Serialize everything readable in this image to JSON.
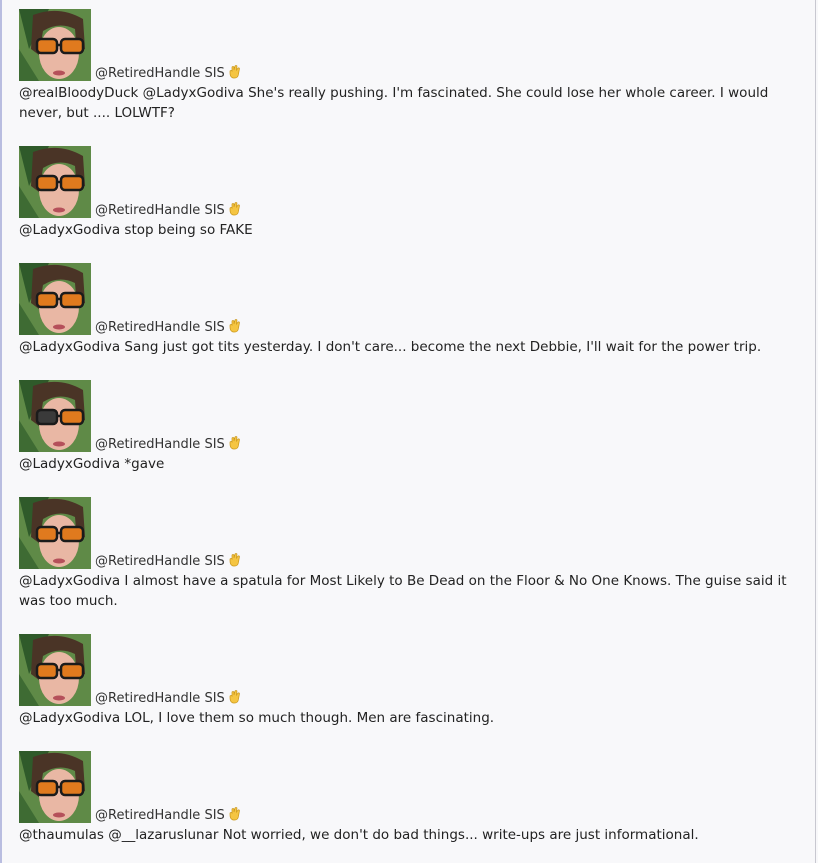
{
  "posts": [
    {
      "handle": "@RetiredHandle SIS",
      "text": "@realBloodyDuck @LadyxGodiva She's really pushing. I'm fascinated. She could lose her whole career. I would never, but .... LOLWTF?"
    },
    {
      "handle": "@RetiredHandle SIS",
      "text": "@LadyxGodiva stop being so FAKE"
    },
    {
      "handle": "@RetiredHandle SIS",
      "text": "@LadyxGodiva Sang just got tits yesterday. I don't care... become the next Debbie, I'll wait for the power trip."
    },
    {
      "handle": "@RetiredHandle SIS",
      "text": "@LadyxGodiva *gave"
    },
    {
      "handle": "@RetiredHandle SIS",
      "text": "@LadyxGodiva I almost have a spatula for Most Likely to Be Dead on the Floor & No One Knows. The guise said it was too much."
    },
    {
      "handle": "@RetiredHandle SIS",
      "text": "@LadyxGodiva LOL, I love them so much though. Men are fascinating."
    },
    {
      "handle": "@RetiredHandle SIS",
      "text": "@thaumulas @__lazaruslunar Not worried, we don't do bad things... write-ups are just informational."
    }
  ],
  "icons": {
    "avatar": "user-photo-avatar",
    "handle_badge": "raised-hand-icon"
  },
  "colors": {
    "background": "#f8f8fa",
    "text": "#222222",
    "left_rule": "#b9bde0",
    "badge": "#f5c542"
  }
}
